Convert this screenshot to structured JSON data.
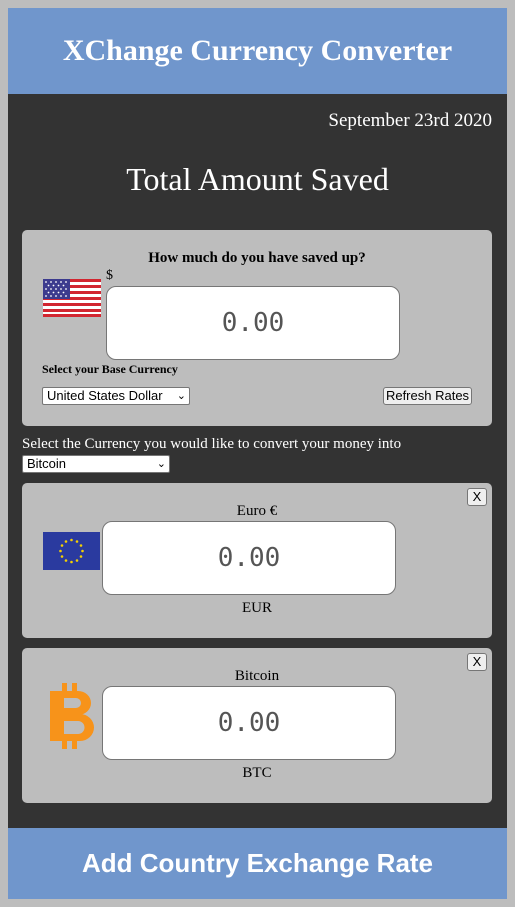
{
  "header": {
    "title": "XChange Currency Converter"
  },
  "date": "September 23rd 2020",
  "total_title": "Total Amount Saved",
  "base": {
    "question": "How much do you have saved up?",
    "symbol": "$",
    "amount": "0.00",
    "select_label": "Select your Base Currency",
    "selected_currency": "United States Dollar",
    "refresh_label": "Refresh Rates",
    "flag_icon": "us-flag"
  },
  "convert": {
    "label": "Select the Currency you would like to convert your money into",
    "selected_currency": "Bitcoin"
  },
  "conversions": [
    {
      "name": "Euro €",
      "code": "EUR",
      "amount": "0.00",
      "close_label": "X",
      "icon": "eu-flag"
    },
    {
      "name": "Bitcoin",
      "code": "BTC",
      "amount": "0.00",
      "close_label": "X",
      "icon": "bitcoin-icon"
    }
  ],
  "footer": {
    "label": "Add Country Exchange Rate"
  },
  "colors": {
    "accent": "#7096cc",
    "background": "#333333",
    "card": "#bdbdbd",
    "bitcoin": "#f7931a",
    "eu_blue": "#2a3a9f",
    "eu_star": "#f5d000"
  }
}
